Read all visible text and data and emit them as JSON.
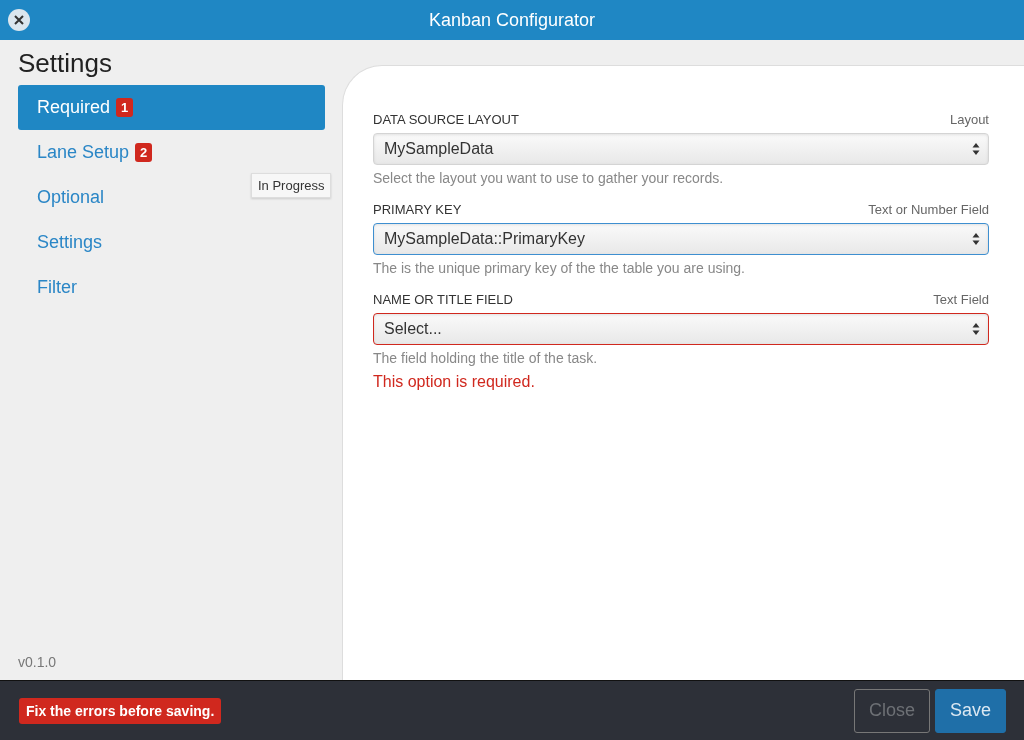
{
  "window": {
    "title": "Kanban Configurator"
  },
  "sidebar": {
    "title": "Settings",
    "items": [
      {
        "label": "Required",
        "badge": "1",
        "selected": true
      },
      {
        "label": "Lane Setup",
        "badge": "2",
        "selected": false
      },
      {
        "label": "Optional",
        "selected": false
      },
      {
        "label": "Settings",
        "selected": false
      },
      {
        "label": "Filter",
        "selected": false
      }
    ],
    "tooltip": "In Progress",
    "version": "v0.1.0"
  },
  "fields": [
    {
      "label": "DATA SOURCE LAYOUT",
      "hint": "Layout",
      "value": "MySampleData",
      "help": "Select the layout you want to use to gather your records.",
      "focused": false,
      "invalid": false
    },
    {
      "label": "PRIMARY KEY",
      "hint": "Text or Number Field",
      "value": "MySampleData::PrimaryKey",
      "help": "The is the unique primary key of the the table you are using.",
      "focused": true,
      "invalid": false
    },
    {
      "label": "NAME OR TITLE FIELD",
      "hint": "Text Field",
      "value": "Select...",
      "help": "The field holding the title of the task.",
      "focused": false,
      "invalid": true,
      "error": "This option is required."
    }
  ],
  "footer": {
    "error": "Fix the errors before saving.",
    "buttons": [
      {
        "label": "Close",
        "kind": "secondary"
      },
      {
        "label": "Save",
        "kind": "primary"
      }
    ]
  }
}
